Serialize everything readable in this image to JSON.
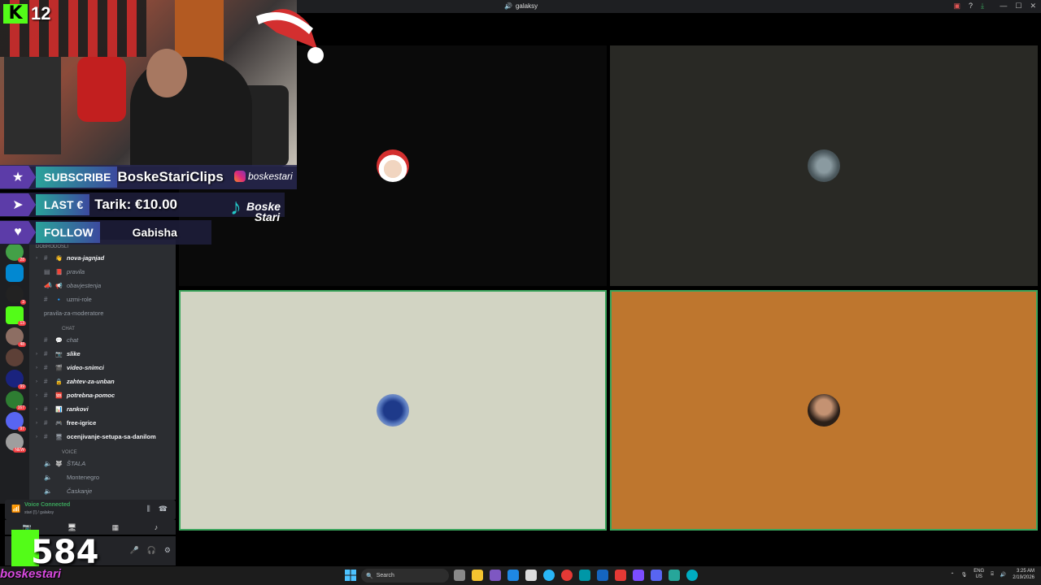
{
  "window": {
    "title": "galaksy"
  },
  "stream": {
    "kick_viewers": "12",
    "subscribe": {
      "label": "SUBSCRIBE",
      "value": "BoskeStariClips"
    },
    "last": {
      "label": "LAST €",
      "value": "Tarik: €10.00"
    },
    "follow": {
      "label": "FOLLOW",
      "value": "Gabisha"
    },
    "instagram": "boskestari",
    "tiktok_line1": "Boske",
    "tiktok_line2": "Stari",
    "counter": "584",
    "streamer_name": "boskestari"
  },
  "channels": {
    "category_top": "DOBRODOSLI",
    "items_top": [
      {
        "emoji": "👋",
        "label": "nova-jagnjad",
        "bold": true
      },
      {
        "emoji": "📕",
        "label": "pravila",
        "bold": false
      },
      {
        "emoji": "📢",
        "label": "obavjestenja",
        "bold": false
      },
      {
        "emoji": "🔹",
        "label": "uzmi-role",
        "bold": false
      },
      {
        "emoji": "",
        "label": "pravila-za-moderatore",
        "bold": false
      }
    ],
    "category_chat": "CHAT",
    "items_chat": [
      {
        "emoji": "💬",
        "label": "chat",
        "bold": false
      },
      {
        "emoji": "📷",
        "label": "slike",
        "bold": true
      },
      {
        "emoji": "🎬",
        "label": "video-snimci",
        "bold": true
      },
      {
        "emoji": "🔒",
        "label": "zahtev-za-unban",
        "bold": true
      },
      {
        "emoji": "🆘",
        "label": "potrebna-pomoc",
        "bold": true
      },
      {
        "emoji": "📊",
        "label": "rankovi",
        "bold": true
      },
      {
        "emoji": "🎮",
        "label": "free-igrice",
        "bold": true
      },
      {
        "emoji": "🖥",
        "label": "ocenjivanje-setupa-sa-danilom",
        "bold": true
      }
    ],
    "category_voice": "VOICE",
    "items_voice": [
      {
        "emoji": "🐺",
        "label": "ŠTALA"
      },
      {
        "emoji": "",
        "label": "Montenegro"
      },
      {
        "emoji": "",
        "label": "Časkanje"
      }
    ]
  },
  "voice": {
    "status": "Voice Connected",
    "channel": "stari [!] / galaksy"
  },
  "taskbar": {
    "search_placeholder": "Search",
    "lang": "ENG",
    "region": "US",
    "time": "3:25 AM",
    "date": "2/19/2026"
  },
  "colors": {
    "kick_green": "#53fc18",
    "voice_green": "#3ba55c",
    "tile_orange": "#be762e",
    "tile_beige": "#d2d4c3",
    "tile_dark": "#292925"
  },
  "server_badges": [
    "28",
    "3",
    "13",
    "48",
    "99",
    "167",
    "97",
    "NEW"
  ]
}
